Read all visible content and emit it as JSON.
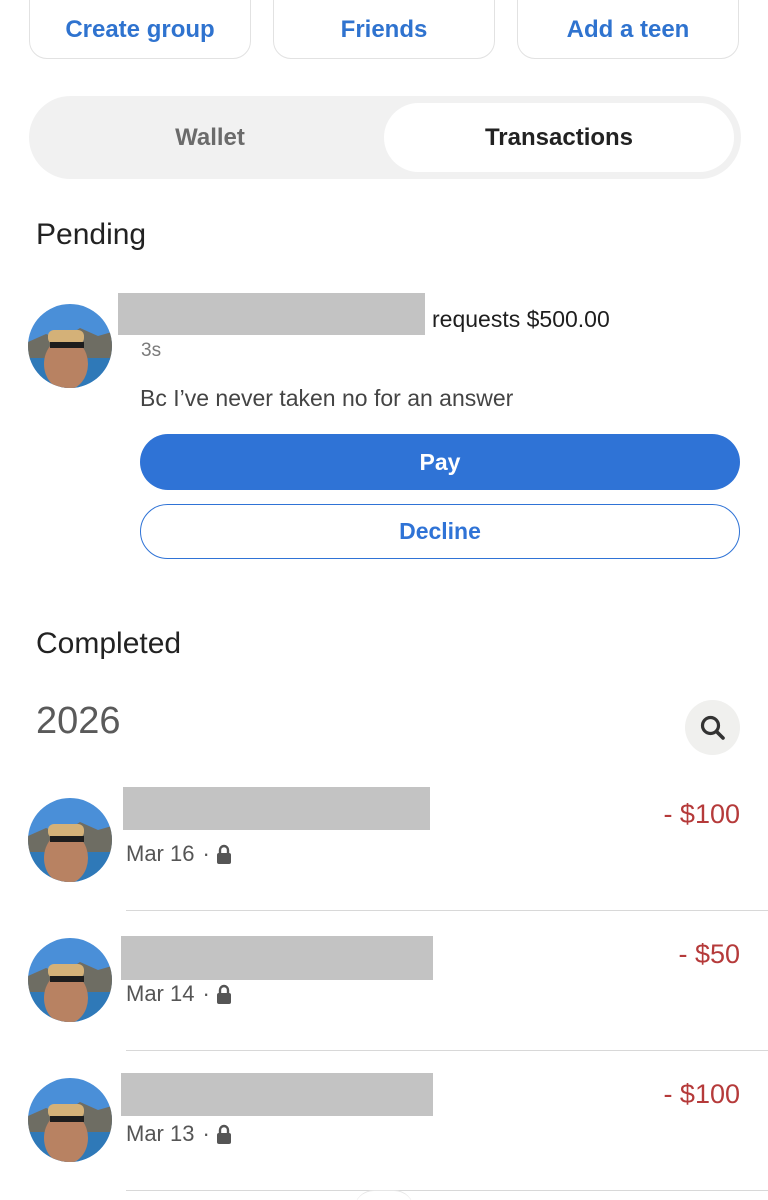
{
  "quick_actions": [
    {
      "label": "Create group"
    },
    {
      "label": "Friends"
    },
    {
      "label": "Add a teen"
    }
  ],
  "tabs": [
    {
      "label": "Wallet",
      "selected": false
    },
    {
      "label": "Transactions",
      "selected": true
    }
  ],
  "pending": {
    "title": "Pending",
    "request_text": "requests $500.00",
    "time": "3s",
    "note": "Bc I’ve never taken no for an answer",
    "pay_label": "Pay",
    "decline_label": "Decline"
  },
  "completed": {
    "title": "Completed",
    "year": "2026",
    "transactions": [
      {
        "date": "Mar 16",
        "separator": "·",
        "amount": "- $100"
      },
      {
        "date": "Mar 14",
        "separator": "·",
        "amount": "- $50"
      },
      {
        "date": "Mar 13",
        "separator": "·",
        "amount": "- $100"
      }
    ]
  },
  "colors": {
    "accent": "#2f73d6",
    "debit": "#b53a3a",
    "redaction": "#c3c3c3"
  },
  "icons": {
    "search": "search-icon",
    "lock": "lock-icon"
  }
}
